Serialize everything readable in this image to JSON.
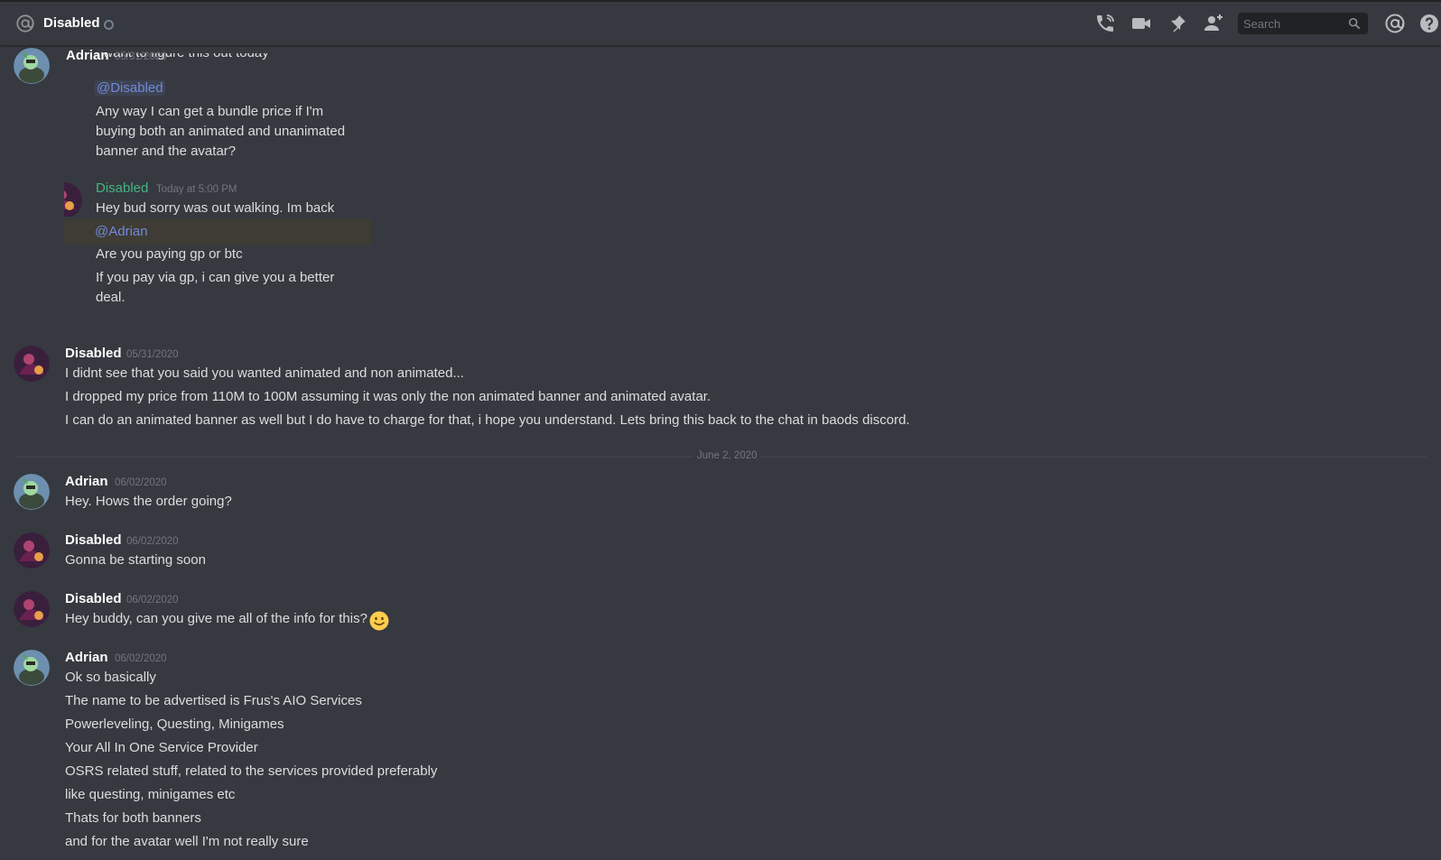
{
  "header": {
    "channel_name": "Disabled",
    "search_placeholder": "Search",
    "icons": [
      "at-icon",
      "call-icon",
      "video-icon",
      "pin-icon",
      "add-friend-icon",
      "search-icon",
      "mentions-icon",
      "help-icon"
    ]
  },
  "quoted": {
    "author": "Adrian",
    "timestamp": "05/31/2020",
    "cut_line": "I want to figure this out today",
    "mention": "@Disabled",
    "lines": [
      "Any way I can get a bundle price if I'm",
      "buying both an animated and unanimated",
      "banner and the avatar?"
    ],
    "reply_author": "Disabled",
    "reply_timestamp": "Today at 5:00 PM",
    "reply_line1": "Hey bud sorry was out walking. Im back",
    "reply_mention": "@Adrian",
    "reply_line2": "Are you paying gp or btc",
    "reply_line3a": "If you pay via gp, i can give you a better",
    "reply_line3b": "deal."
  },
  "messages": [
    {
      "author": "Disabled",
      "timestamp": "05/31/2020",
      "lines": [
        "I didnt see that you said you wanted animated and non animated...",
        "I dropped my price from 110M to 100M assuming it was only the non animated banner and animated avatar.",
        "I can do an animated banner as well but I do have to charge for that, i hope you understand. Lets bring this back to the chat in baods discord."
      ]
    },
    {
      "author": "Adrian",
      "timestamp": "06/02/2020",
      "lines": [
        "Hey. Hows the order going?"
      ]
    },
    {
      "author": "Disabled",
      "timestamp": "06/02/2020",
      "lines": [
        "Gonna be starting soon"
      ]
    },
    {
      "author": "Disabled",
      "timestamp": "06/02/2020",
      "lines": [
        "Hey buddy, can you give me all of the info for this?"
      ]
    },
    {
      "author": "Adrian",
      "timestamp": "06/02/2020",
      "lines": [
        "Ok so basically",
        "The name to be advertised is Frus's AIO Services",
        "Powerleveling, Questing, Minigames",
        "Your All In One Service Provider",
        "OSRS related stuff, related to the services provided preferably",
        "like questing, minigames etc",
        "Thats for both banners",
        "and for the avatar well I'm not really sure"
      ]
    }
  ],
  "date_divider": "June 2, 2020",
  "colors": {
    "background": "#36393f",
    "header_border": "#202225",
    "mention": "#7289da",
    "reply_author": "#43b581",
    "timestamp": "#72767d",
    "text": "#dcddde"
  }
}
